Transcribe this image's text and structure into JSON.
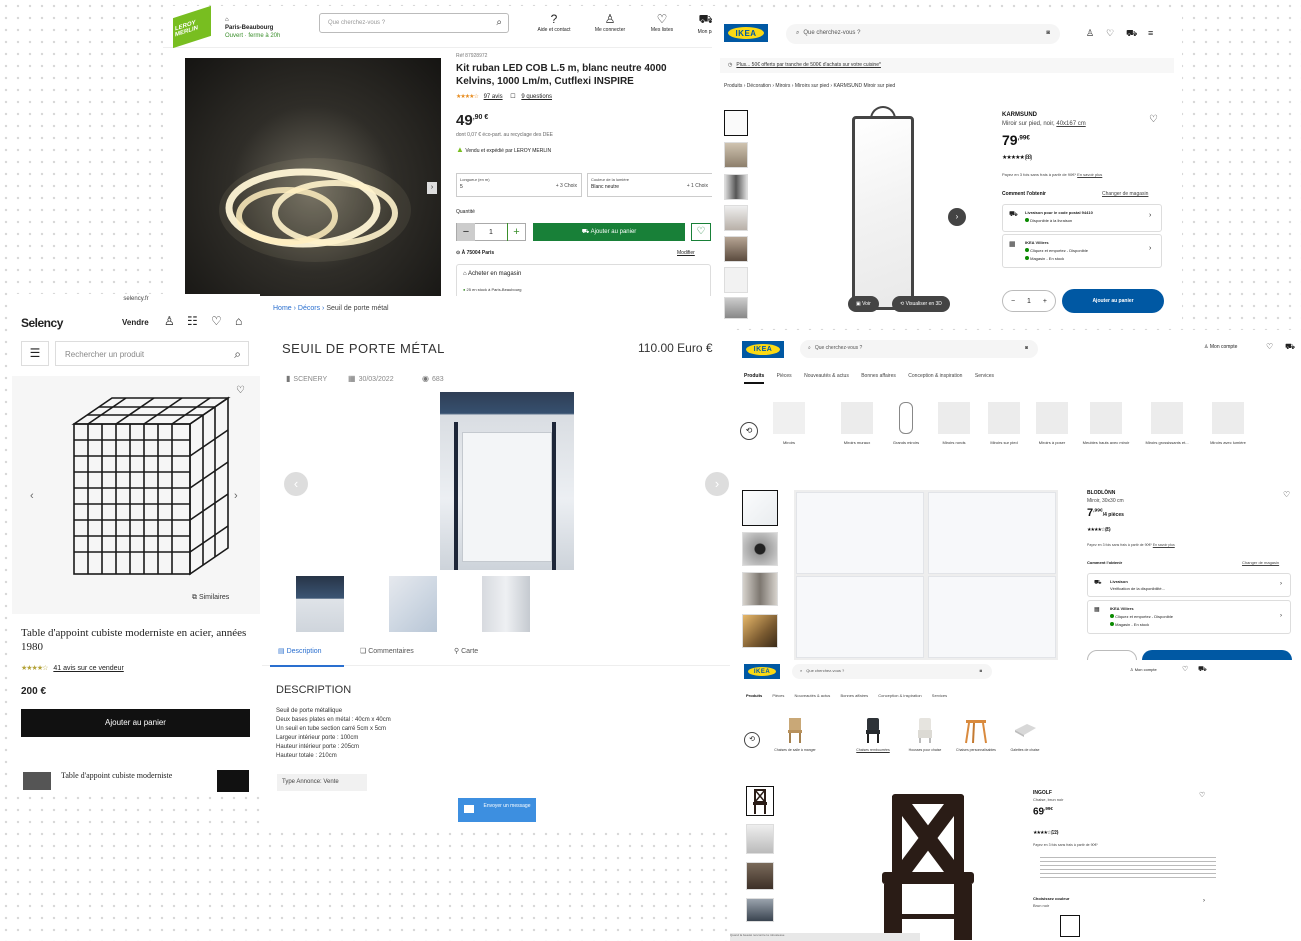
{
  "leroy": {
    "logo_text": "LEROY MERLIN",
    "store_name": "Paris-Beaubourg",
    "store_status": "Ouvert · ferme à 20h",
    "search_placeholder": "Que cherchez-vous ?",
    "nav": [
      "Aide et contact",
      "Me connecter",
      "Mes listes",
      "Mon pa"
    ],
    "ref": "Réf 87928972",
    "title": "Kit ruban LED COB L.5 m, blanc neutre 4000 Kelvins, 1000 Lm/m, Cutflexi INSPIRE",
    "stars": "★★★★☆",
    "reviews": "97 avis",
    "questions": "9 questions",
    "price_int": "49",
    "price_dec": ",90 €",
    "eco_part": "dont 0,07 € éco-part. au recyclage des DEE",
    "sold_by": "Vendu et expédié par LEROY MERLIN",
    "option1_label": "Longueur (en m)",
    "option1_value": "5",
    "option1_choices": "+ 3 Choix",
    "option2_label": "Couleur de la lumière",
    "option2_value": "Blanc neutre",
    "option2_choices": "+ 1 Choix",
    "qty_label": "Quantité",
    "qty": "1",
    "add_to_cart": "Ajouter au panier",
    "location": "À 75004 Paris",
    "modify": "Modifier",
    "store_pickup": "Acheter en magasin",
    "stock": "25 en stock à Paris-Beaubourg"
  },
  "selency": {
    "url": "selency.fr",
    "logo": "Selency",
    "sell": "Vendre",
    "search_placeholder": "Rechercher un produit",
    "similar": "Similaires",
    "title": "Table d'appoint cubiste moderniste en acier, années 1980",
    "stars": "★★★★☆",
    "reviews": "41 avis sur ce vendeur",
    "price": "200 €",
    "add_to_cart": "Ajouter au panier",
    "mini_title": "Table d'appoint cubiste moderniste"
  },
  "annonce": {
    "breadcrumb": [
      "Home",
      "Décors",
      "Seuil de porte métal"
    ],
    "title": "SEUIL DE PORTE MÉTAL",
    "price": "110.00 Euro €",
    "seller": "SCENERY",
    "date": "30/03/2022",
    "views": "683",
    "tabs": [
      "Description",
      "Commentaires",
      "Carte"
    ],
    "desc_title": "DESCRIPTION",
    "desc_lines": [
      "Seuil de porte métallique",
      "Deux bases plates en métal : 40cm x 40cm",
      "Un seuil en tube section carré 5cm x 5cm",
      "Largeur intérieur porte : 100cm",
      "Hauteur intérieur porte : 205cm",
      "Hauteur totale : 210cm"
    ],
    "type_label": "Type Annonce:",
    "type_value": "Vente",
    "message_button": "Envoyer un message"
  },
  "ikea1": {
    "logo": "IKEA",
    "search_placeholder": "Que cherchez-vous ?",
    "promo": "Plus... 50€ offerts par tranche de 500€ d'achats sur votre cuisine*",
    "breadcrumb": "Produits › Décoration › Miroirs › Miroirs sur pied › KARMSUND Miroir sur pied",
    "product_name": "KARMSUND",
    "product_desc": "Miroir sur pied, noir,",
    "product_size": "40x167 cm",
    "price_int": "79",
    "price_dec": ",99€",
    "stars": "★★★★★",
    "reviews": "(88)",
    "installments": "Payez en 3 fois sans frais à partir de 90€*",
    "installments_link": "En savoir plus",
    "how_label": "Comment l'obtenir",
    "change_store": "Changer de magasin",
    "delivery_title": "Livraison pour le code postal 94410",
    "delivery_status": "Disponible à la livraison",
    "store_title": "IKEA Villiers",
    "store_status1": "Cliquez et emportez - Disponible",
    "store_status2": "Magasin - En stock",
    "qty": "1",
    "add_to_cart": "Ajouter au panier",
    "overlay_view": "Voir",
    "overlay_3d": "Visualiser en 3D"
  },
  "ikea2": {
    "logo": "IKEA",
    "search_placeholder": "Que cherchez-vous ?",
    "account": "Mon compte",
    "tabs": [
      "Produits",
      "Pièces",
      "Nouveautés & actus",
      "Bonnes affaires",
      "Conception & inspiration",
      "Services"
    ],
    "categories": [
      "Miroirs",
      "Miroirs muraux",
      "Grands miroirs",
      "Miroirs ronds",
      "Miroirs sur pied",
      "Miroirs à poser",
      "Meubles hauts avec miroir",
      "Miroirs grossissants et...",
      "Miroirs avec lumière"
    ],
    "product_name": "BLODLÖNN",
    "product_desc": "Miroir, 30x30 cm",
    "price_int": "7",
    "price_dec": ",99€",
    "price_unit": "/4 pièces",
    "stars": "★★★★☆",
    "reviews": "(85)",
    "installments": "Payez en 3 fois sans frais à partir de 90€*",
    "installments_link": "En savoir plus",
    "how_label": "Comment l'obtenir",
    "change_store": "Changer de magasin",
    "delivery_title": "Livraison",
    "delivery_status": "Vérification de la disponibilité...",
    "store_title": "IKEA Villiers",
    "store_status1": "Cliquez et emportez - Disponible",
    "store_status2": "Magasin - En stock"
  },
  "ikea3": {
    "logo": "IKEA",
    "search_placeholder": "Que cherchez-vous ?",
    "account": "Mon compte",
    "tabs": [
      "Produits",
      "Pièces",
      "Nouveautés & actus",
      "Bonnes affaires",
      "Conception & inspiration",
      "Services"
    ],
    "categories": [
      "Chaises de salle à manger",
      "Chaises rembourrées",
      "Housses pour chaise",
      "Chaises personnalisables",
      "Galettes de chaise"
    ],
    "product_name": "INGOLF",
    "product_desc": "Chaise, brun noir",
    "price_int": "69",
    "price_dec": ",99€",
    "stars": "★★★★☆",
    "reviews": "(133)",
    "installments": "Payez en 3 fois sans frais à partir de 90€*",
    "finish_label": "Choisissez couleur",
    "finish_value": "Brun noir",
    "footer": "Quand la beauté rencontre la robustesse"
  }
}
